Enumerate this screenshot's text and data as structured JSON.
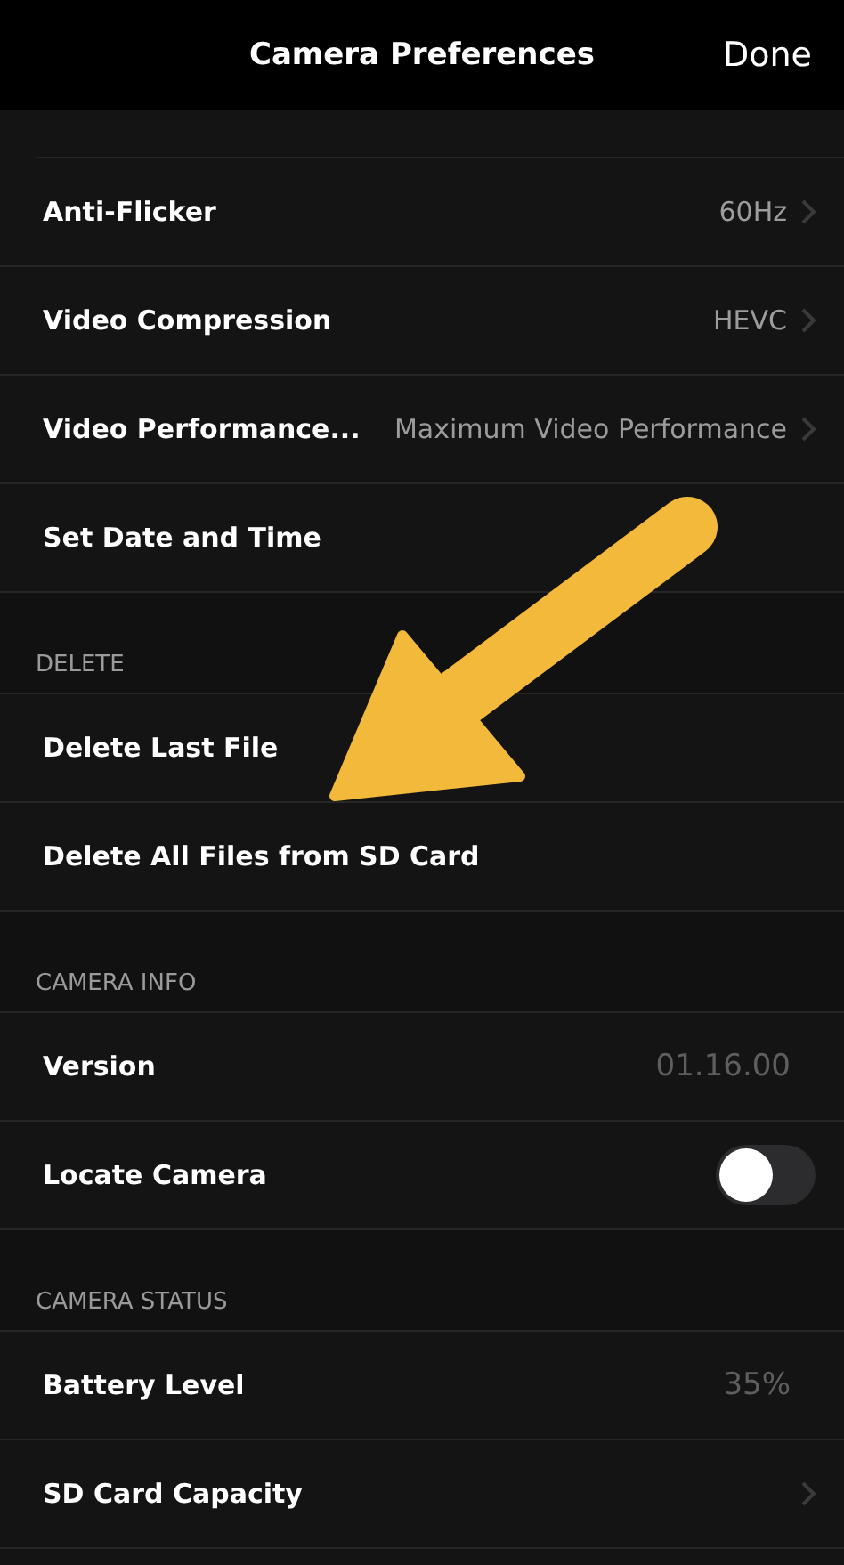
{
  "header": {
    "title": "Camera Preferences",
    "done": "Done"
  },
  "sections": [
    {
      "rows": [
        {
          "kind": "value",
          "label": "Anti-Flicker",
          "value": "60Hz"
        },
        {
          "kind": "value",
          "label": "Video Compression",
          "value": "HEVC"
        },
        {
          "kind": "value",
          "label": "Video Performance...",
          "value": "Maximum Video Performance"
        },
        {
          "kind": "plain",
          "label": "Set Date and Time"
        }
      ]
    },
    {
      "title": "DELETE",
      "rows": [
        {
          "kind": "plain",
          "label": "Delete Last File"
        },
        {
          "kind": "plain",
          "label": "Delete All Files from SD Card"
        }
      ]
    },
    {
      "title": "CAMERA INFO",
      "rows": [
        {
          "kind": "info",
          "label": "Version",
          "value": "01.16.00"
        },
        {
          "kind": "toggle",
          "label": "Locate Camera",
          "on": false
        }
      ]
    },
    {
      "title": "CAMERA STATUS",
      "rows": [
        {
          "kind": "info",
          "label": "Battery Level",
          "value": "35%"
        },
        {
          "kind": "value",
          "label": "SD Card Capacity"
        }
      ]
    }
  ]
}
